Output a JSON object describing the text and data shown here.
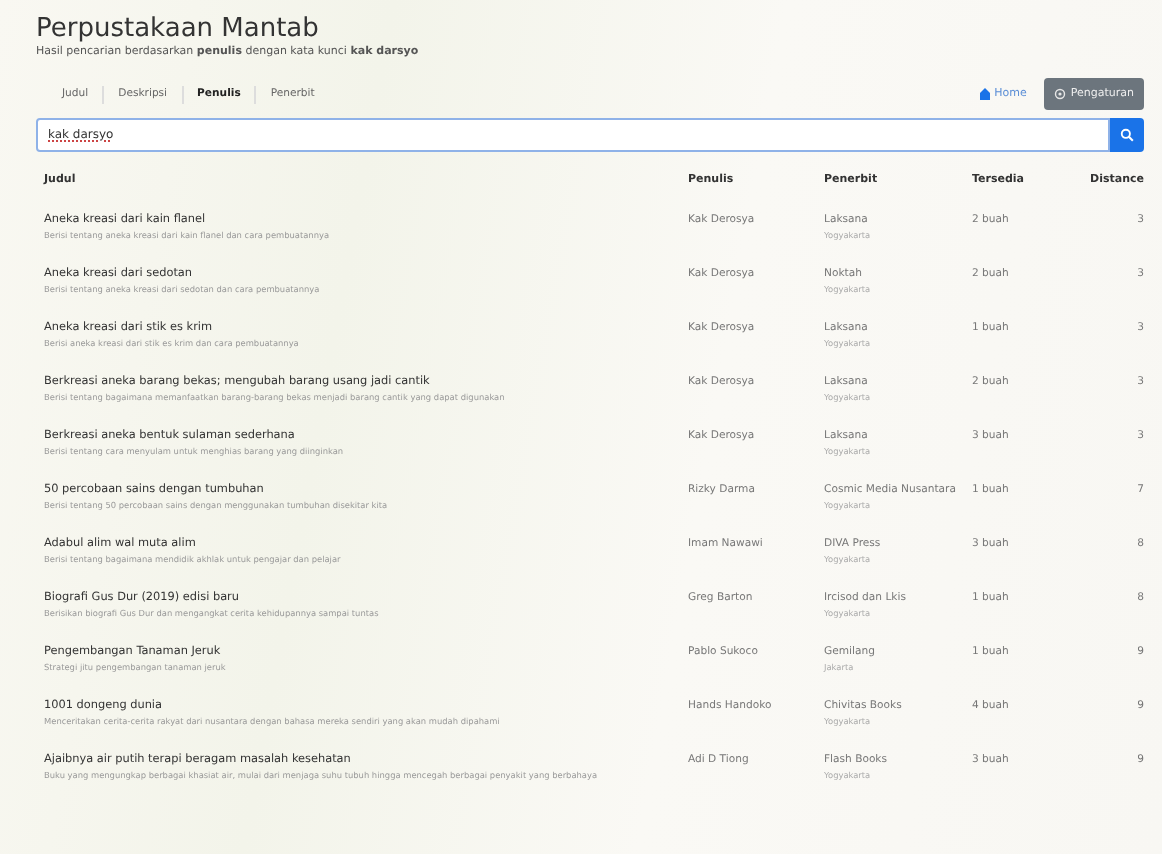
{
  "title": "Perpustakaan Mantab",
  "subtitle": "Hasil pencarian berdasarkan **penulis** dengan kata kunci **kak darsyo**",
  "tabs": [
    {
      "label": "Judul",
      "selected": false
    },
    {
      "label": "Deskripsi",
      "selected": false
    },
    {
      "label": "Penulis",
      "selected": true
    },
    {
      "label": "Penerbit",
      "selected": false
    }
  ],
  "home_link": "Home",
  "settings_button": "Pengaturan",
  "search": {
    "value": "kak darsyo"
  },
  "table": {
    "columns": [
      "Judul",
      "Penulis",
      "Penerbit",
      "Tersedia",
      "Distance"
    ],
    "rows": [
      {
        "title": "Aneka kreasi dari kain flanel",
        "description": "Berisi tentang aneka kreasi dari kain flanel dan cara pembuatannya",
        "author": "Kak Derosya",
        "publisher": "Laksana",
        "city": "Yogyakarta",
        "available": "2 buah",
        "distance": "3"
      },
      {
        "title": "Aneka kreasi dari sedotan",
        "description": "Berisi tentang aneka kreasi dari sedotan dan cara pembuatannya",
        "author": "Kak Derosya",
        "publisher": "Noktah",
        "city": "Yogyakarta",
        "available": "2 buah",
        "distance": "3"
      },
      {
        "title": "Aneka kreasi dari stik es krim",
        "description": "Berisi aneka kreasi dari stik es krim dan cara pembuatannya",
        "author": "Kak Derosya",
        "publisher": "Laksana",
        "city": "Yogyakarta",
        "available": "1 buah",
        "distance": "3"
      },
      {
        "title": "Berkreasi aneka barang bekas; mengubah barang usang jadi cantik",
        "description": "Berisi tentang bagaimana memanfaatkan barang-barang bekas menjadi barang cantik yang dapat digunakan",
        "author": "Kak Derosya",
        "publisher": "Laksana",
        "city": "Yogyakarta",
        "available": "2 buah",
        "distance": "3"
      },
      {
        "title": "Berkreasi aneka bentuk sulaman sederhana",
        "description": "Berisi tentang cara menyulam untuk menghias barang yang diinginkan",
        "author": "Kak Derosya",
        "publisher": "Laksana",
        "city": "Yogyakarta",
        "available": "3 buah",
        "distance": "3"
      },
      {
        "title": "50 percobaan sains dengan tumbuhan",
        "description": "Berisi tentang 50 percobaan sains dengan menggunakan tumbuhan disekitar kita",
        "author": "Rizky Darma",
        "publisher": "Cosmic Media Nusantara",
        "city": "Yogyakarta",
        "available": "1 buah",
        "distance": "7"
      },
      {
        "title": "Adabul alim wal muta alim",
        "description": "Berisi tentang bagaimana mendidik akhlak untuk pengajar dan pelajar",
        "author": "Imam Nawawi",
        "publisher": "DIVA Press",
        "city": "Yogyakarta",
        "available": "3 buah",
        "distance": "8"
      },
      {
        "title": "Biografi Gus Dur (2019) edisi baru",
        "description": "Berisikan biografi Gus Dur dan mengangkat cerita kehidupannya sampai tuntas",
        "author": "Greg Barton",
        "publisher": "Ircisod dan Lkis",
        "city": "Yogyakarta",
        "available": "1 buah",
        "distance": "8"
      },
      {
        "title": "Pengembangan Tanaman Jeruk",
        "description": "Strategi jitu pengembangan tanaman jeruk",
        "author": "Pablo Sukoco",
        "publisher": "Gemilang",
        "city": "Jakarta",
        "available": "1 buah",
        "distance": "9"
      },
      {
        "title": "1001 dongeng dunia",
        "description": "Menceritakan cerita-cerita rakyat dari nusantara dengan bahasa mereka sendiri yang akan mudah dipahami",
        "author": "Hands Handoko",
        "publisher": "Chivitas Books",
        "city": "Yogyakarta",
        "available": "4 buah",
        "distance": "9"
      },
      {
        "title": "Ajaibnya air putih terapi beragam masalah kesehatan",
        "description": "Buku yang mengungkap berbagai khasiat air, mulai dari menjaga suhu tubuh hingga mencegah berbagai penyakit yang berbahaya",
        "author": "Adi D Tiong",
        "publisher": "Flash Books",
        "city": "Yogyakarta",
        "available": "3 buah",
        "distance": "9"
      }
    ]
  }
}
